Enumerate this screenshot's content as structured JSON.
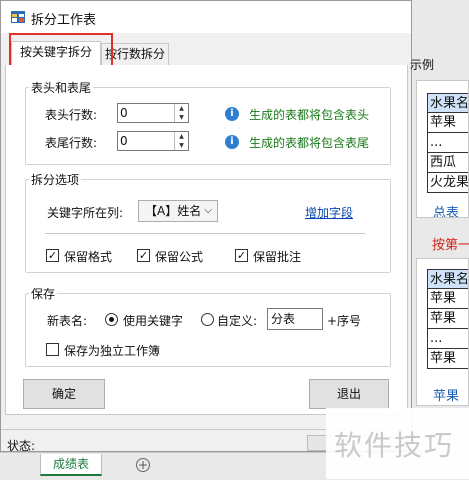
{
  "window": {
    "title": "拆分工作表"
  },
  "tabs": [
    {
      "label": "按关键字拆分"
    },
    {
      "label": "按行数拆分"
    }
  ],
  "header_footer": {
    "title": "表头和表尾",
    "header_rows_label": "表头行数:",
    "header_rows_value": "0",
    "footer_rows_label": "表尾行数:",
    "footer_rows_value": "0",
    "header_hint": "生成的表都将包含表头",
    "footer_hint": "生成的表都将包含表尾"
  },
  "split_options": {
    "title": "拆分选项",
    "keyword_col_label": "关键字所在列:",
    "keyword_col_value": "【A】姓名",
    "add_field_link": "增加字段",
    "keep_format": "保留格式",
    "keep_formula": "保留公式",
    "keep_comment": "保留批注",
    "keep_format_checked": true,
    "keep_formula_checked": true,
    "keep_comment_checked": true
  },
  "save": {
    "title": "保存",
    "new_name_label": "新表名:",
    "use_keyword_label": "使用关键字",
    "custom_label": "自定义:",
    "custom_value": "分表",
    "suffix_label": "+序号",
    "separate_workbook_label": "保存为独立工作簿",
    "use_keyword_selected": true,
    "separate_workbook_checked": false
  },
  "buttons": {
    "ok": "确定",
    "exit": "退出"
  },
  "status": {
    "label": "状态:"
  },
  "example": {
    "title": "示例",
    "top_rows": [
      "水果名",
      "苹果",
      "...",
      "西瓜",
      "火龙果"
    ],
    "top_sheet_tab": "总表",
    "arrow_text": "按第一",
    "bottom_rows": [
      "水果名",
      "苹果",
      "苹果",
      "...",
      "苹果"
    ],
    "bottom_sheet_tab": "苹果"
  },
  "sheet_tabs": {
    "active": "成绩表"
  },
  "watermark": "软件技巧"
}
